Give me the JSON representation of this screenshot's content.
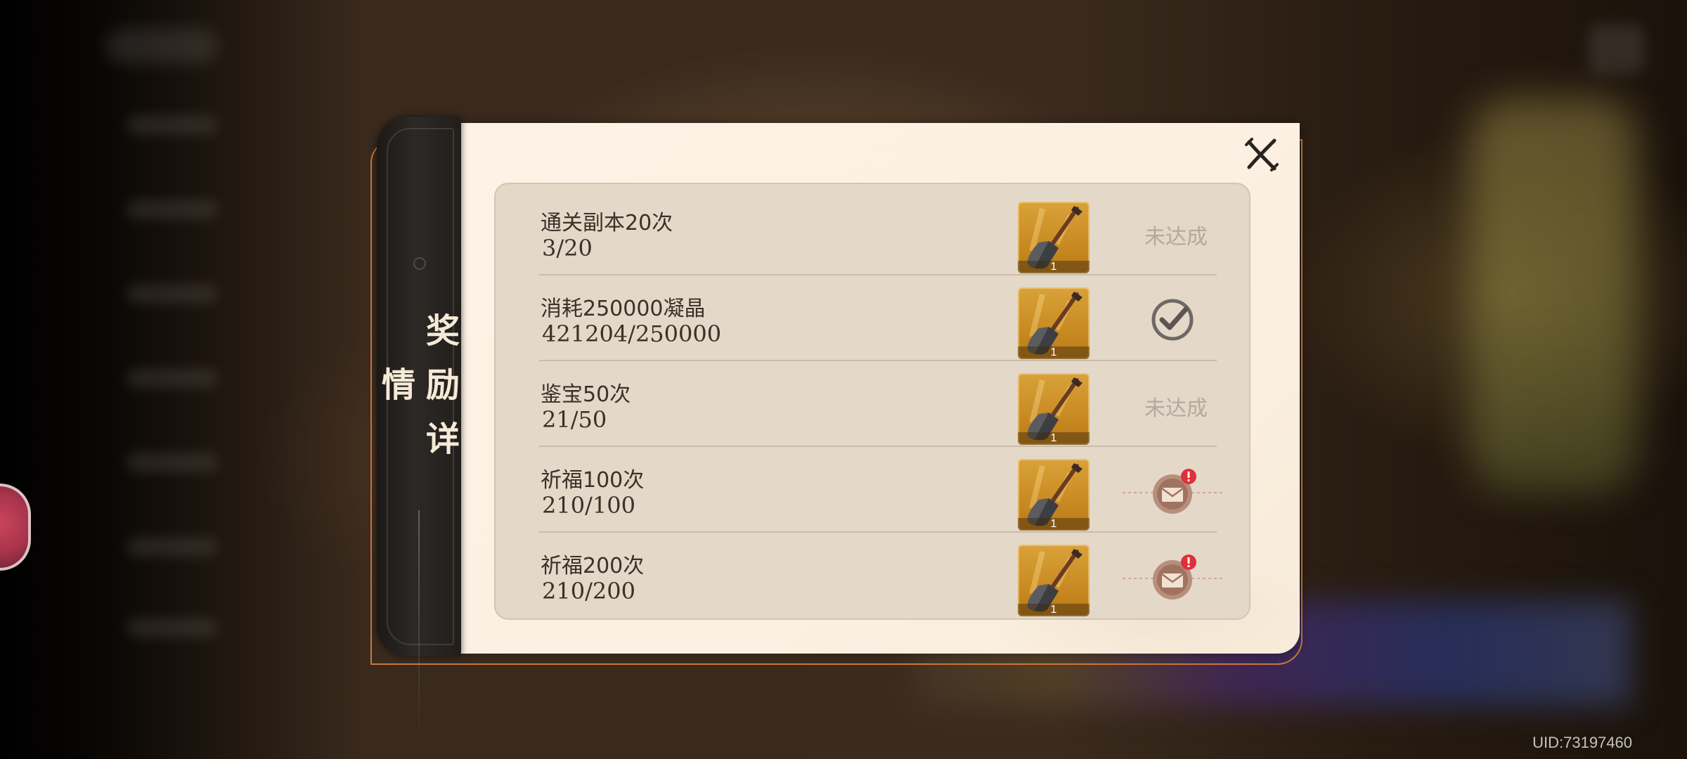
{
  "dialog": {
    "title_chars": [
      "奖",
      "励",
      "详",
      "情"
    ]
  },
  "rewards": [
    {
      "task": "通关副本20次",
      "progress": "3/20",
      "item_icon": "shovel-icon",
      "item_count": "1",
      "status": "not_reached",
      "status_text": "未达成"
    },
    {
      "task": "消耗250000凝晶",
      "progress": "421204/250000",
      "item_icon": "shovel-icon",
      "item_count": "1",
      "status": "claimed",
      "status_text": ""
    },
    {
      "task": "鉴宝50次",
      "progress": "21/50",
      "item_icon": "shovel-icon",
      "item_count": "1",
      "status": "not_reached",
      "status_text": "未达成"
    },
    {
      "task": "祈福100次",
      "progress": "210/100",
      "item_icon": "shovel-icon",
      "item_count": "1",
      "status": "claimable",
      "status_text": ""
    },
    {
      "task": "祈福200次",
      "progress": "210/200",
      "item_icon": "shovel-icon",
      "item_count": "1",
      "status": "claimable",
      "status_text": ""
    }
  ],
  "footer": {
    "uid": "UID:73197460"
  },
  "colors": {
    "panel": "#fcf3e6",
    "list_bg": "#e4d8c9",
    "tab_dark": "#2c2926",
    "accent_outline": "#c8773c",
    "item_gold": "#d9a23a",
    "alert_red": "#e0303a"
  }
}
